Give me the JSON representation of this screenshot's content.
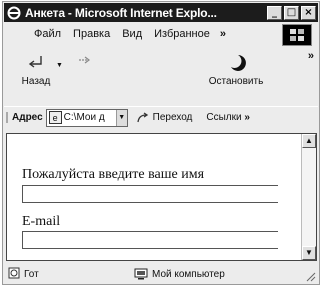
{
  "window": {
    "title": "Анкета - Microsoft Internet Explo...",
    "buttons": {
      "minimize": "_",
      "maximize": "□",
      "close": "×"
    }
  },
  "menu": {
    "items": [
      {
        "label": "Файл"
      },
      {
        "label": "Правка"
      },
      {
        "label": "Вид"
      },
      {
        "label": "Избранное"
      }
    ],
    "more": "»"
  },
  "toolbar": {
    "back_label": "Назад",
    "forward_label": "",
    "stop_label": "Остановить",
    "more": "»"
  },
  "address": {
    "label": "Адрес",
    "value": "C:\\Мои д",
    "go_label": "Переход",
    "links_label": "Ссылки",
    "links_more": "»"
  },
  "form": {
    "name_label": "Пожалуйста  введите ваше имя",
    "name_value": "",
    "email_label": "E-mail",
    "email_value": ""
  },
  "status": {
    "text": "Гот",
    "zone": "Мой компьютер"
  }
}
